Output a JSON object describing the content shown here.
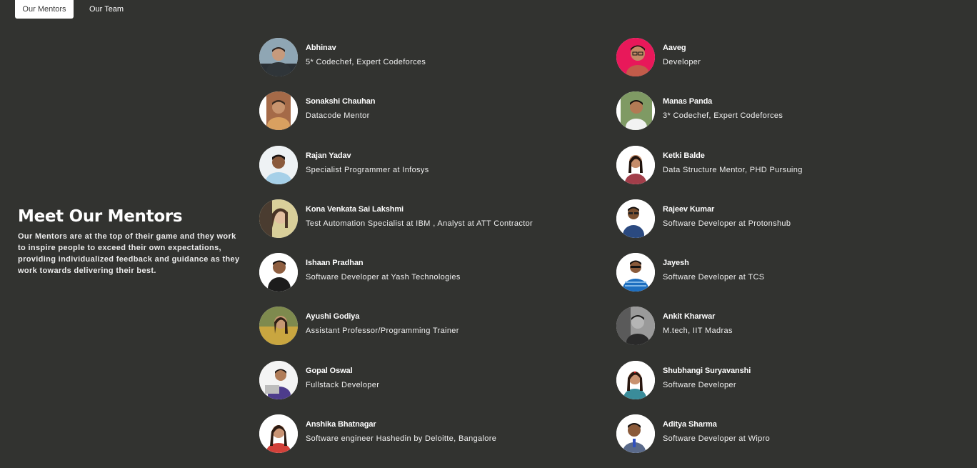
{
  "tabs": [
    {
      "label": "Our Mentors",
      "active": true
    },
    {
      "label": "Our Team",
      "active": false
    }
  ],
  "intro": {
    "title": "Meet Our Mentors",
    "description": "Our Mentors are at the top of their game and they work to inspire people to exceed their own expectations, providing individualized feedback and guidance as they work towards delivering their best."
  },
  "mentors_left": [
    {
      "name": "Abhinav",
      "role": "5* Codechef, Expert Codeforces"
    },
    {
      "name": "Sonakshi Chauhan",
      "role": "Datacode Mentor"
    },
    {
      "name": "Rajan Yadav",
      "role": "Specialist Programmer at Infosys"
    },
    {
      "name": "Kona Venkata Sai Lakshmi",
      "role": "Test Automation Specialist at IBM , Analyst at ATT Contractor"
    },
    {
      "name": "Ishaan Pradhan",
      "role": "Software Developer at Yash Technologies"
    },
    {
      "name": "Ayushi Godiya",
      "role": "Assistant Professor/Programming Trainer"
    },
    {
      "name": "Gopal Oswal",
      "role": "Fullstack Developer"
    },
    {
      "name": "Anshika Bhatnagar",
      "role": "Software engineer Hashedin by Deloitte, Bangalore"
    }
  ],
  "mentors_right": [
    {
      "name": "Aaveg",
      "role": "Developer"
    },
    {
      "name": "Manas Panda",
      "role": "3* Codechef, Expert Codeforces"
    },
    {
      "name": "Ketki Balde",
      "role": "Data Structure Mentor, PHD Pursuing"
    },
    {
      "name": "Rajeev Kumar",
      "role": "Software Developer at Protonshub"
    },
    {
      "name": "Jayesh",
      "role": "Software Developer at TCS"
    },
    {
      "name": "Ankit Kharwar",
      "role": "M.tech, IIT Madras"
    },
    {
      "name": "Shubhangi Suryavanshi",
      "role": "Software Developer"
    },
    {
      "name": "Aditya Sharma",
      "role": "Software Developer at Wipro"
    }
  ],
  "colors": {
    "background": "#323330",
    "tab_active_bg": "#ffffff",
    "text": "#ffffff"
  }
}
